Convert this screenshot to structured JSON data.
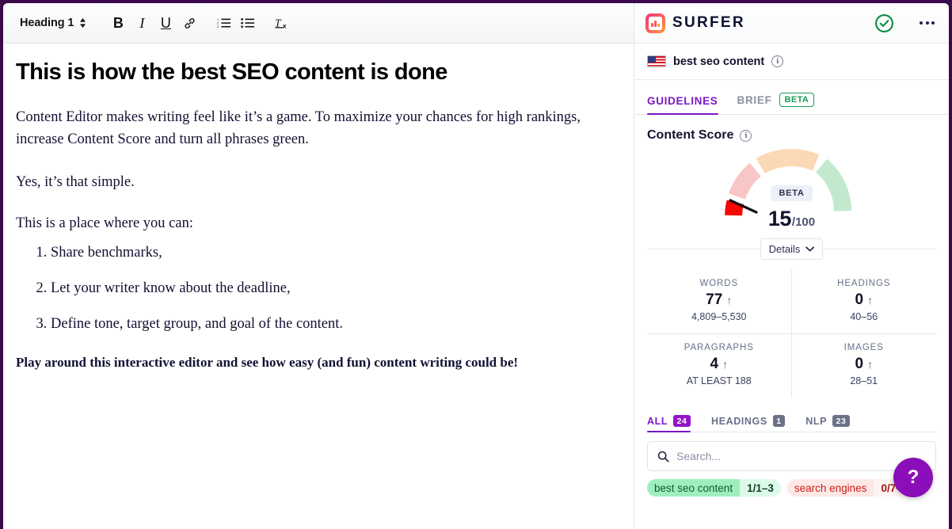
{
  "editor": {
    "toolbar": {
      "style_label": "Heading 1",
      "buttons": [
        {
          "name": "bold",
          "glyph": "B"
        },
        {
          "name": "italic",
          "glyph": "I"
        },
        {
          "name": "underline",
          "glyph": "U"
        },
        {
          "name": "link",
          "glyph": "link"
        },
        {
          "name": "ordered-list",
          "glyph": "ol"
        },
        {
          "name": "bullet-list",
          "glyph": "ul"
        },
        {
          "name": "clear-format",
          "glyph": "Tx"
        }
      ]
    },
    "document": {
      "title": "This is how the best SEO content is done",
      "paragraph_1": "Content Editor makes writing feel like it’s a game. To maximize your chances for high rankings, increase Content Score and turn all phrases green.",
      "paragraph_2": "Yes, it’s that simple.",
      "paragraph_3": "This is a place where you can:",
      "list": [
        "Share benchmarks,",
        "Let your writer know about the deadline,",
        "Define tone, target group, and goal of the content."
      ],
      "paragraph_4": "Play around this interactive editor and see how easy (and fun) content writing could be!"
    }
  },
  "panel": {
    "brand": "SURFER",
    "keyword": {
      "flag": "us-flag-icon",
      "name": "best seo content",
      "info": "i"
    },
    "top_tabs": [
      {
        "label": "GUIDELINES",
        "active": true,
        "badge": null
      },
      {
        "label": "BRIEF",
        "active": false,
        "badge": "BETA"
      }
    ],
    "content_score": {
      "heading": "Content Score",
      "info": "i",
      "beta_label": "BETA",
      "value": "15",
      "denominator": "/100",
      "details_label": "Details"
    },
    "stats": [
      {
        "label": "WORDS",
        "value": "77",
        "arrow": "↑",
        "range": "4,809–5,530"
      },
      {
        "label": "HEADINGS",
        "value": "0",
        "arrow": "↑",
        "range": "40–56"
      },
      {
        "label": "PARAGRAPHS",
        "value": "4",
        "arrow": "↑",
        "range": "AT LEAST 188"
      },
      {
        "label": "IMAGES",
        "value": "0",
        "arrow": "↑",
        "range": "28–51"
      }
    ],
    "bottom_tabs": [
      {
        "label": "ALL",
        "count": "24",
        "active": true
      },
      {
        "label": "HEADINGS",
        "count": "1",
        "active": false
      },
      {
        "label": "NLP",
        "count": "23",
        "active": false
      }
    ],
    "search": {
      "value": "",
      "placeholder": "Search..."
    },
    "terms": [
      {
        "name": "best seo content",
        "value": "1/1–3",
        "status": "green"
      },
      {
        "name": "search engines",
        "value": "0/7–16",
        "status": "red"
      }
    ],
    "help_label": "?"
  },
  "chart_data": {
    "type": "gauge",
    "title": "Content Score",
    "value": 15,
    "min": 0,
    "max": 100,
    "unit": "/100",
    "segments": [
      {
        "name": "poor-filled",
        "from": 0,
        "to": 15,
        "color": "#fb0505"
      },
      {
        "name": "poor",
        "from": 15,
        "to": 27,
        "color": "#f9c6c6"
      },
      {
        "name": "fair",
        "from": 29,
        "to": 60,
        "color": "#fbd9b6"
      },
      {
        "name": "good",
        "from": 63,
        "to": 100,
        "color": "#c2e8ce"
      }
    ],
    "needle_value": 15
  },
  "colors": {
    "brand_purple": "#7a18c4",
    "help_purple": "#8a0fb8",
    "ok_green": "#18a05a",
    "score_red": "#fb0505"
  }
}
